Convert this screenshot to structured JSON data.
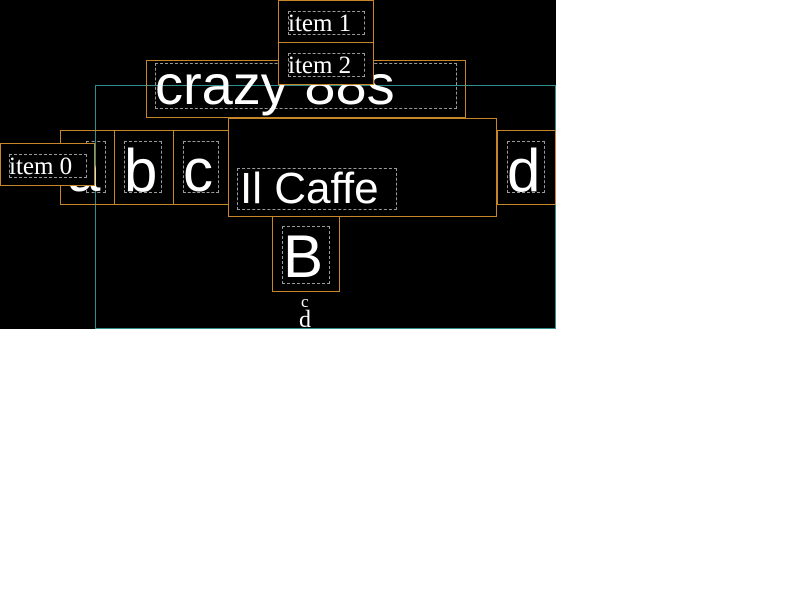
{
  "colors": {
    "background": "#000000",
    "text": "#ffffff",
    "box_border": "#c8862a",
    "frame_border": "#2f8f8f",
    "inner_border": "#9a9a9a"
  },
  "title": "crazy 88s",
  "letters": [
    "a",
    "b",
    "c",
    "d"
  ],
  "caption": "Il Caffe",
  "big_letter": "B",
  "small_letters": [
    "c",
    "d"
  ],
  "items": [
    "item 0",
    "item 1",
    "item 2"
  ]
}
